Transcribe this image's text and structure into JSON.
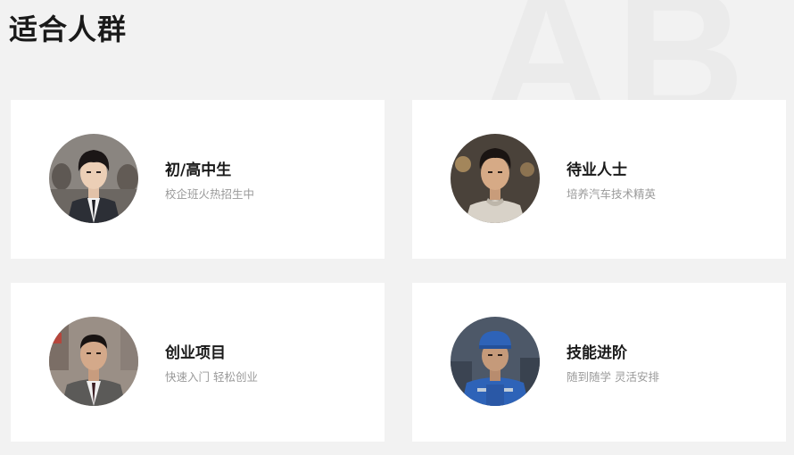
{
  "section": {
    "title": "适合人群",
    "watermark": "AB"
  },
  "cards": [
    {
      "title": "初/高中生",
      "subtitle": "校企班火热招生中",
      "avatar_icon": "student-portrait-icon"
    },
    {
      "title": "待业人士",
      "subtitle": "培养汽车技术精英",
      "avatar_icon": "young-man-portrait-icon"
    },
    {
      "title": "创业项目",
      "subtitle": "快速入门 轻松创业",
      "avatar_icon": "businessman-portrait-icon"
    },
    {
      "title": "技能进阶",
      "subtitle": "随到随学 灵活安排",
      "avatar_icon": "mechanic-portrait-icon"
    }
  ]
}
